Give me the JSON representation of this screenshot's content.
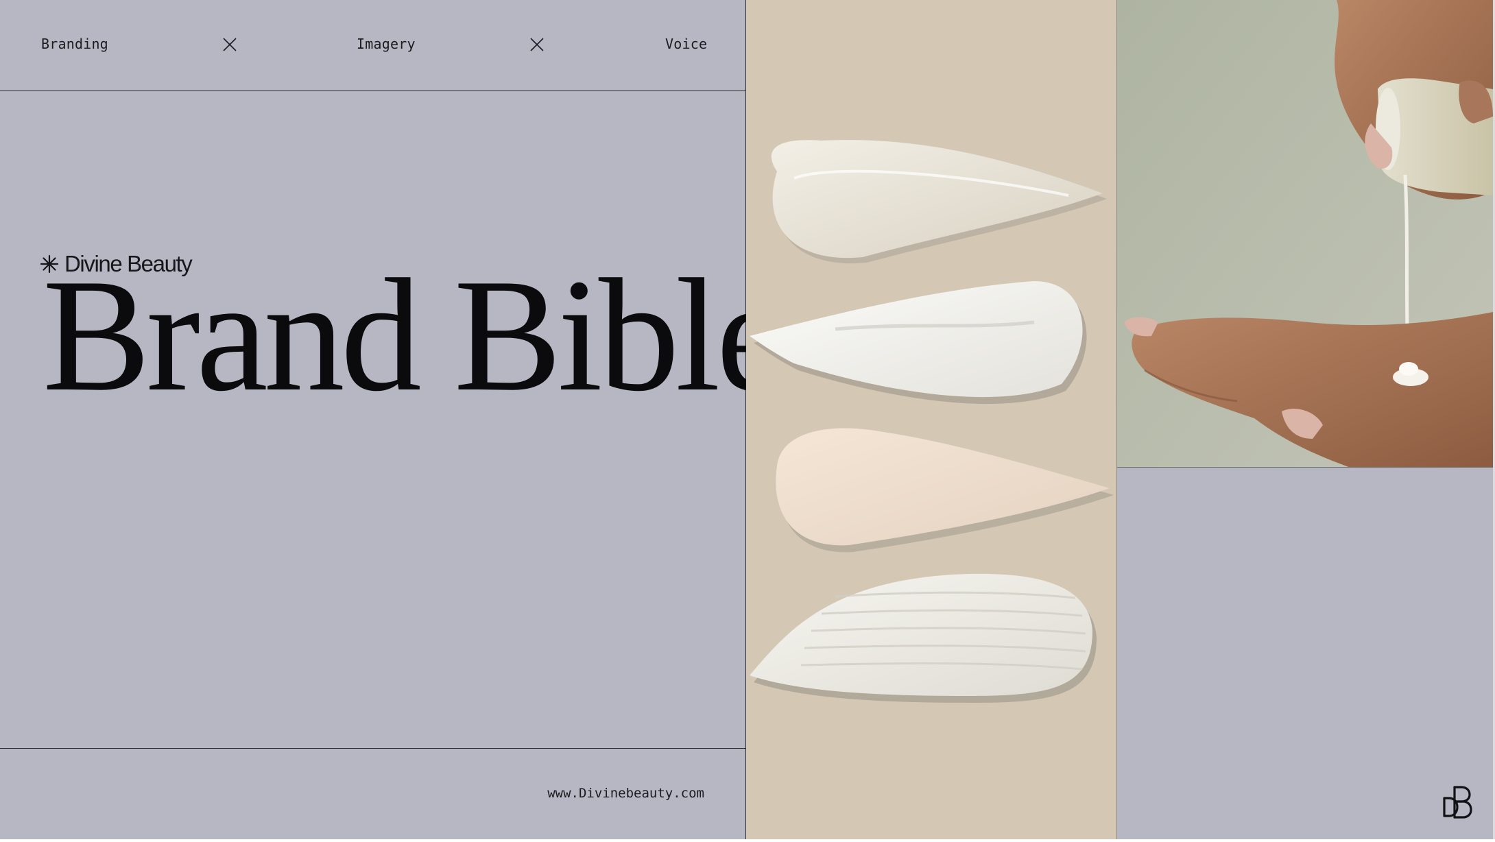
{
  "nav": {
    "items": [
      {
        "label": "Branding"
      },
      {
        "label": "Imagery"
      },
      {
        "label": "Voice"
      }
    ],
    "separator_icon": "close-icon"
  },
  "brand": {
    "name": "Divine Beauty",
    "icon": "asterisk-star-icon",
    "monogram": "DB"
  },
  "hero": {
    "title": "Brand Bible"
  },
  "footer": {
    "url": "www.Divinebeauty.com"
  },
  "colors": {
    "background": "#b7b6c3",
    "swatch_panel": "#d4c8b5",
    "photo_bg": "#b9bcaa",
    "ink": "#0b0b0d"
  }
}
